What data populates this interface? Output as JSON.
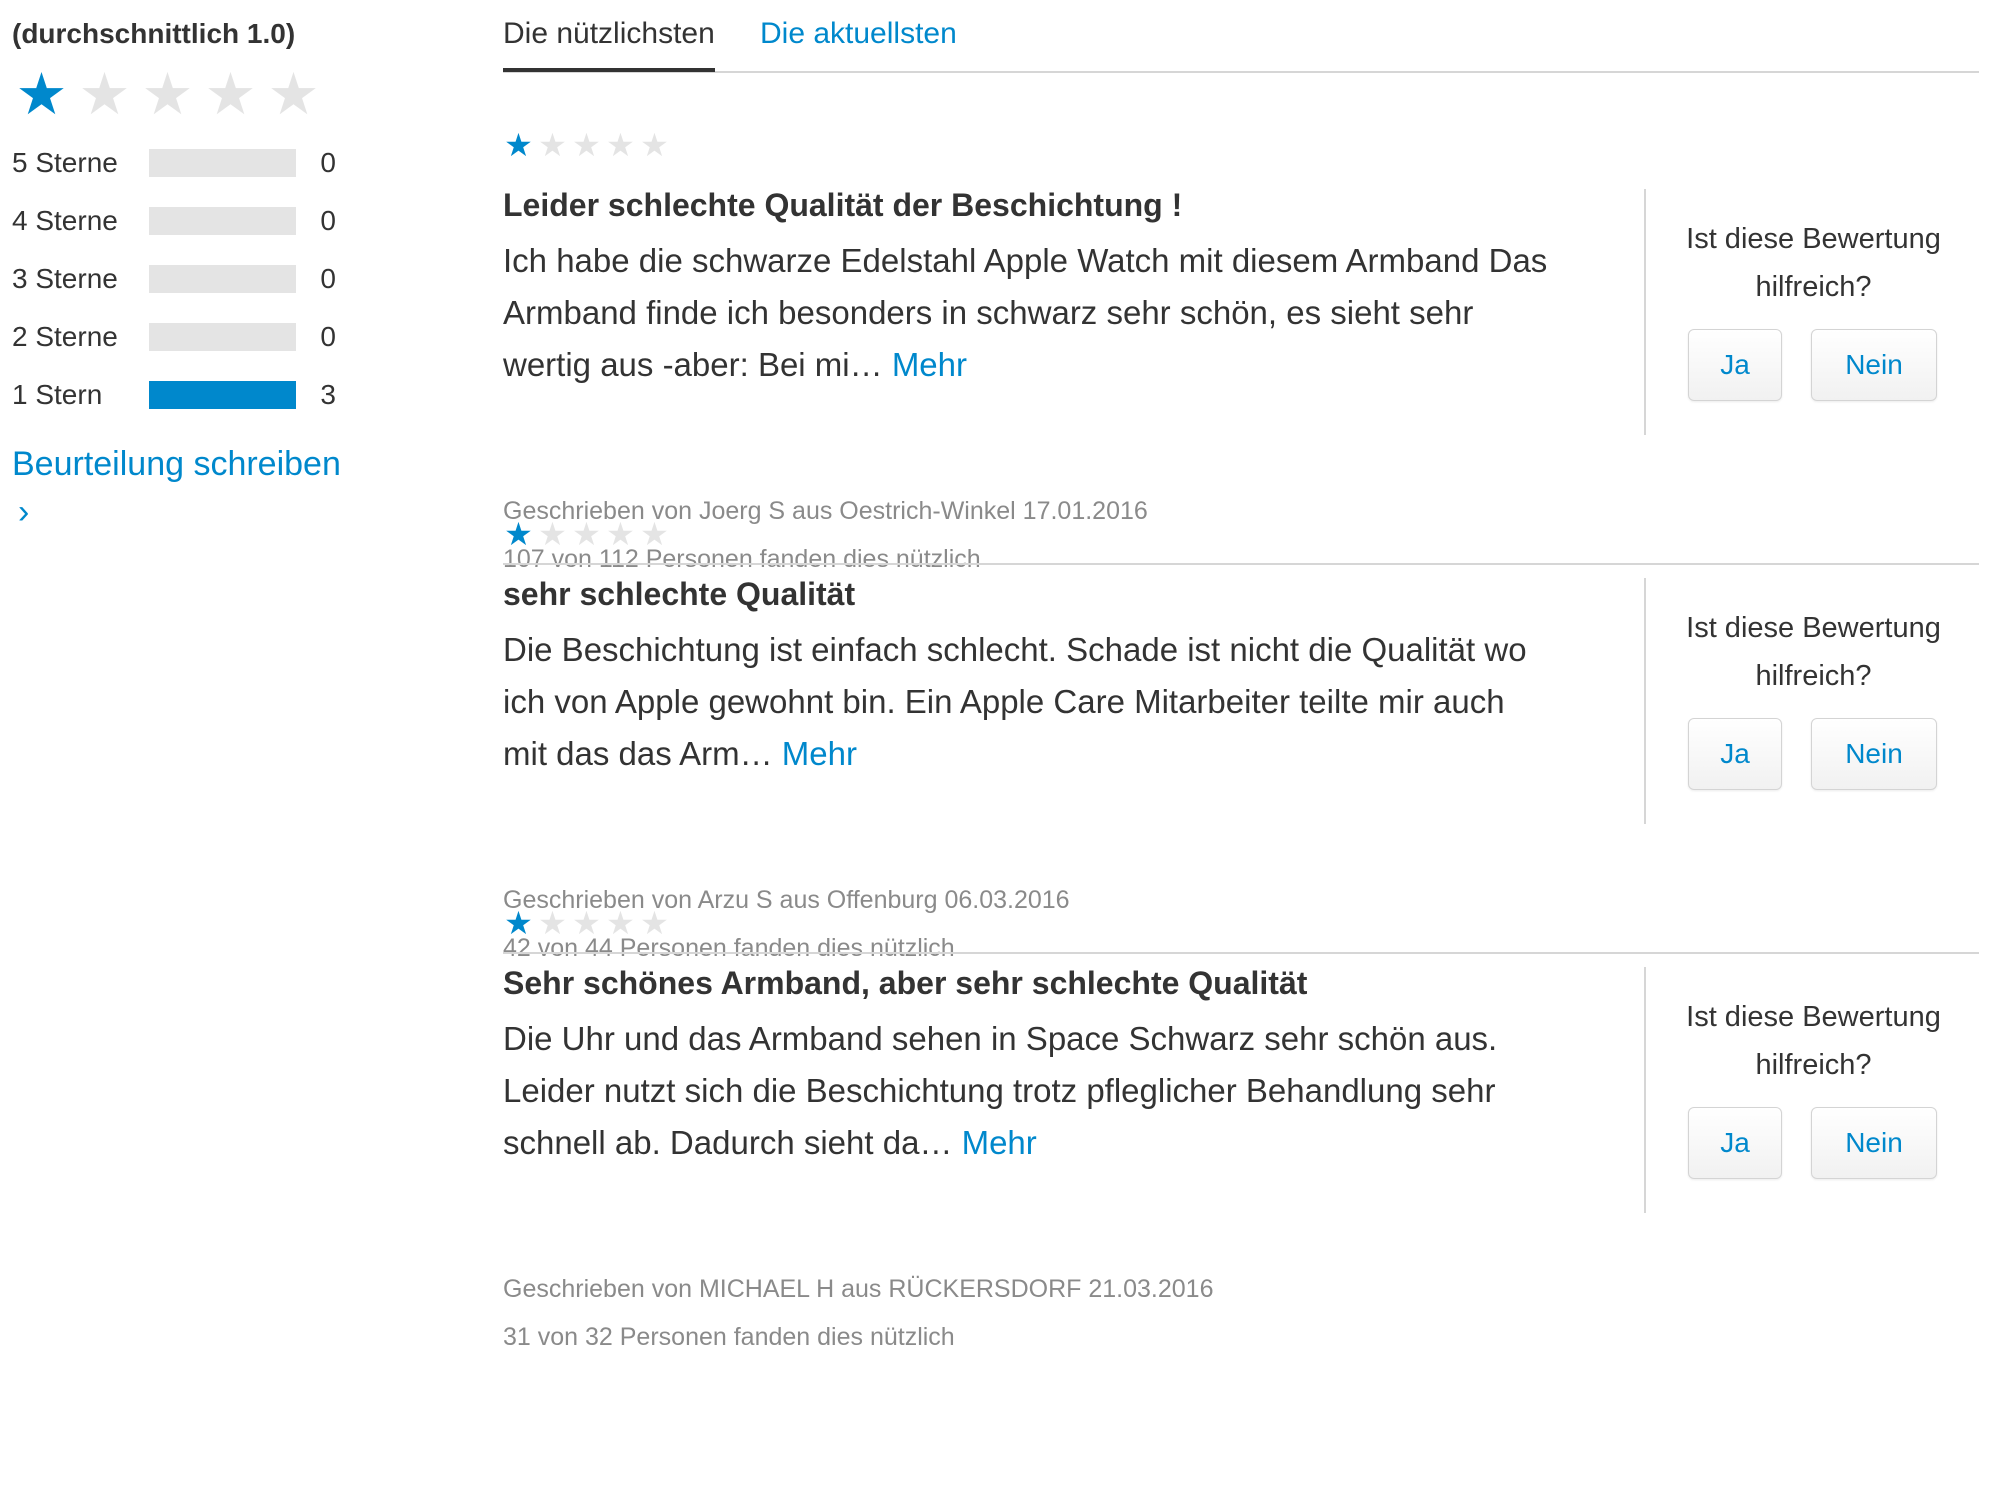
{
  "summary": {
    "average_label": "(durchschnittlich 1.0)",
    "average_rating": 1.0,
    "max_rating": 5,
    "histogram": [
      {
        "label": "5 Sterne",
        "count": "0",
        "fraction": 0
      },
      {
        "label": "4 Sterne",
        "count": "0",
        "fraction": 0
      },
      {
        "label": "3 Sterne",
        "count": "0",
        "fraction": 0
      },
      {
        "label": "2 Sterne",
        "count": "0",
        "fraction": 0
      },
      {
        "label": "1 Stern",
        "count": "3",
        "fraction": 1
      }
    ],
    "write_review_label": "Beurteilung schreiben",
    "write_review_chevron": "›"
  },
  "tabs": [
    {
      "label": "Die nützlichsten",
      "active": true
    },
    {
      "label": "Die aktuellsten",
      "active": false
    }
  ],
  "reviews": [
    {
      "rating": 1,
      "title": "Leider schlechte Qualität der Beschichtung !",
      "body_lines": [
        "Ich habe die schwarze Edelstahl Apple Watch mit diesem Armband Das",
        "Armband finde ich besonders in schwarz sehr schön, es sieht sehr",
        "wertig aus -aber: Bei mi…"
      ],
      "more_label": "Mehr",
      "author_line": "Geschrieben von Joerg S aus Oestrich-Winkel 17.01.2016",
      "helpful_line": "107 von 112 Personen fanden dies nützlich",
      "helpful_question_line1": "Ist diese Bewertung",
      "helpful_question_line2": "hilfreich?",
      "yes_label": "Ja",
      "no_label": "Nein"
    },
    {
      "rating": 1,
      "title": "sehr schlechte Qualität",
      "body_lines": [
        "Die Beschichtung ist einfach schlecht. Schade ist nicht die Qualität wo",
        "ich von Apple gewohnt bin. Ein Apple Care Mitarbeiter teilte mir auch",
        "mit das das Arm…"
      ],
      "more_label": "Mehr",
      "author_line": "Geschrieben von Arzu S aus Offenburg 06.03.2016",
      "helpful_line": "42 von 44 Personen fanden dies nützlich",
      "helpful_question_line1": "Ist diese Bewertung",
      "helpful_question_line2": "hilfreich?",
      "yes_label": "Ja",
      "no_label": "Nein"
    },
    {
      "rating": 1,
      "title": "Sehr schönes Armband, aber sehr schlechte Qualität",
      "body_lines": [
        "Die Uhr und das Armband sehen in Space Schwarz sehr schön aus.",
        "Leider nutzt sich die Beschichtung trotz pfleglicher Behandlung sehr",
        "schnell ab. Dadurch sieht da…"
      ],
      "more_label": "Mehr",
      "author_line": "Geschrieben von MICHAEL H aus RÜCKERSDORF 21.03.2016",
      "helpful_line": "31 von 32 Personen fanden dies nützlich",
      "helpful_question_line1": "Ist diese Bewertung",
      "helpful_question_line2": "hilfreich?",
      "yes_label": "Ja",
      "no_label": "Nein"
    }
  ],
  "colors": {
    "accent": "#0088cc",
    "star_off": "#e4e4e4",
    "text": "#333333",
    "meta_text": "#8a8a8a",
    "divider": "#d6d6d6"
  },
  "icons": {
    "star_filled": "star-filled-icon",
    "star_empty": "star-empty-icon",
    "chevron": "chevron-right-icon"
  }
}
